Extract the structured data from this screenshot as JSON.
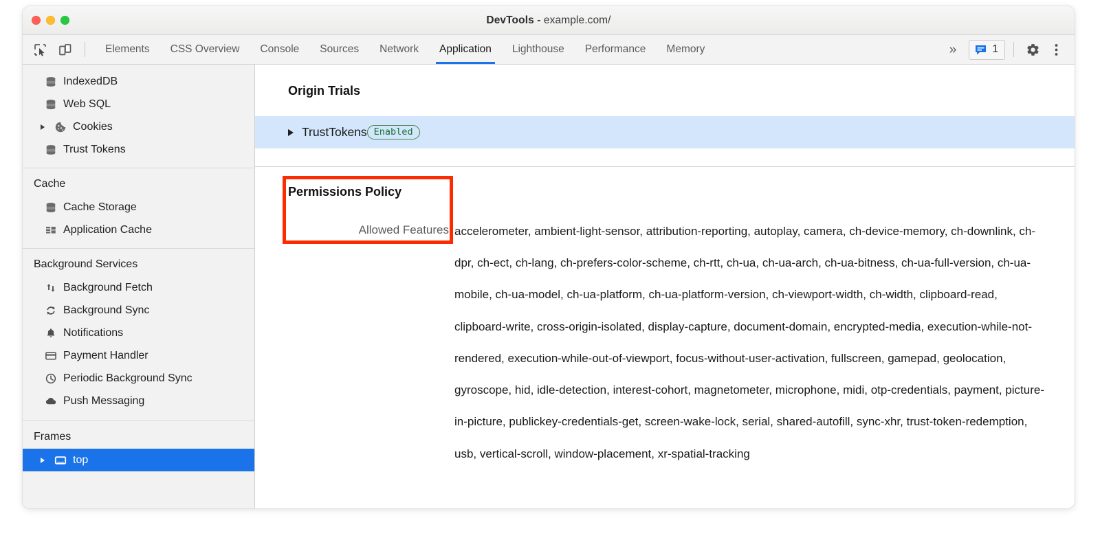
{
  "window": {
    "title_bold": "DevTools -",
    "title_plain": " example.com/",
    "traffic_lights": [
      "close",
      "minimize",
      "maximize"
    ]
  },
  "toolbar": {
    "inspect_icon": "inspect-element-icon",
    "device_icon": "device-toolbar-icon",
    "tabs": [
      {
        "label": "Elements",
        "active": false
      },
      {
        "label": "CSS Overview",
        "active": false
      },
      {
        "label": "Console",
        "active": false
      },
      {
        "label": "Sources",
        "active": false
      },
      {
        "label": "Network",
        "active": false
      },
      {
        "label": "Application",
        "active": true
      },
      {
        "label": "Lighthouse",
        "active": false
      },
      {
        "label": "Performance",
        "active": false
      },
      {
        "label": "Memory",
        "active": false
      }
    ],
    "overflow_label": "»",
    "message_count": "1",
    "message_icon": "message-bubble-icon",
    "settings_icon": "gear-icon",
    "more_icon": "three-dot-menu-icon",
    "active_tab_color": "#1a73e8"
  },
  "sidebar": {
    "sections": [
      {
        "header": null,
        "items": [
          {
            "label": "IndexedDB",
            "icon": "database-icon",
            "twisty": false,
            "selected": false
          },
          {
            "label": "Web SQL",
            "icon": "database-icon",
            "twisty": false,
            "selected": false
          },
          {
            "label": "Cookies",
            "icon": "cookie-icon",
            "twisty": true,
            "selected": false
          },
          {
            "label": "Trust Tokens",
            "icon": "database-icon",
            "twisty": false,
            "selected": false
          }
        ]
      },
      {
        "header": "Cache",
        "items": [
          {
            "label": "Cache Storage",
            "icon": "database-icon",
            "twisty": false,
            "selected": false
          },
          {
            "label": "Application Cache",
            "icon": "grid-icon",
            "twisty": false,
            "selected": false
          }
        ]
      },
      {
        "header": "Background Services",
        "items": [
          {
            "label": "Background Fetch",
            "icon": "up-down-arrows-icon",
            "twisty": false,
            "selected": false
          },
          {
            "label": "Background Sync",
            "icon": "refresh-circular-icon",
            "twisty": false,
            "selected": false
          },
          {
            "label": "Notifications",
            "icon": "bell-icon",
            "twisty": false,
            "selected": false
          },
          {
            "label": "Payment Handler",
            "icon": "credit-card-icon",
            "twisty": false,
            "selected": false
          },
          {
            "label": "Periodic Background Sync",
            "icon": "clock-icon",
            "twisty": false,
            "selected": false
          },
          {
            "label": "Push Messaging",
            "icon": "cloud-icon",
            "twisty": false,
            "selected": false
          }
        ]
      },
      {
        "header": "Frames",
        "items": [
          {
            "label": "top",
            "icon": "frame-icon",
            "twisty": true,
            "selected": true
          }
        ]
      }
    ],
    "selected_bg": "#1a73e8"
  },
  "content": {
    "origin_trials": {
      "title": "Origin Trials",
      "row": {
        "name": "TrustTokens",
        "badge": "Enabled",
        "badge_color": "#137333",
        "row_bg": "#d3e6fb"
      }
    },
    "permissions_policy": {
      "title": "Permissions Policy",
      "allowed_features_label": "Allowed Features",
      "allowed_features_value": "accelerometer, ambient-light-sensor, attribution-reporting, autoplay, camera, ch-device-memory, ch-downlink, ch-dpr, ch-ect, ch-lang, ch-prefers-color-scheme, ch-rtt, ch-ua, ch-ua-arch, ch-ua-bitness, ch-ua-full-version, ch-ua-mobile, ch-ua-model, ch-ua-platform, ch-ua-platform-version, ch-viewport-width, ch-width, clipboard-read, clipboard-write, cross-origin-isolated, display-capture, document-domain, encrypted-media, execution-while-not-rendered, execution-while-out-of-viewport, focus-without-user-activation, fullscreen, gamepad, geolocation, gyroscope, hid, idle-detection, interest-cohort, magnetometer, microphone, midi, otp-credentials, payment, picture-in-picture, publickey-credentials-get, screen-wake-lock, serial, shared-autofill, sync-xhr, trust-token-redemption, usb, vertical-scroll, window-placement, xr-spatial-tracking"
    }
  },
  "annotation": {
    "highlight_color": "#fb2b02"
  }
}
